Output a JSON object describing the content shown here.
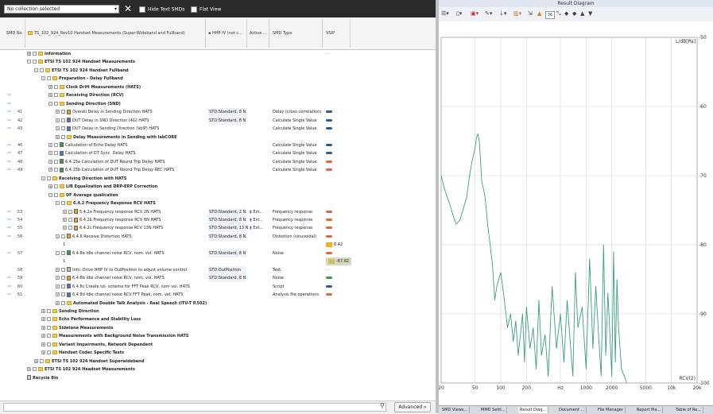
{
  "toolbar": {
    "collection": "No collection selected",
    "hide_text": "Hide Text SMDs",
    "flat_view": "Flat View"
  },
  "header": {
    "smd_no": "SMD No",
    "name": "TS_102_924_Rev10 Handset Measurements (Super-Wideband and Fullband)",
    "hhp": "HHP IV (not c...",
    "active": "Active ...",
    "smd_type": "SMD Type",
    "vsip": "VSIP"
  },
  "rows": [
    {
      "num": "",
      "arrow": "",
      "indent": 0,
      "icon": "folder",
      "pm": "+",
      "bold": true,
      "name": "Information",
      "hhp": "",
      "act": "",
      "smd": "",
      "vsip": "",
      "vsip_kind": "dash"
    },
    {
      "num": "",
      "arrow": "",
      "indent": 0,
      "icon": "folder",
      "pm": "-",
      "bold": true,
      "name": "ETSI TS 102 924 Handset Measurements",
      "hhp": "",
      "act": "",
      "smd": "",
      "vsip": "",
      "vsip_kind": ""
    },
    {
      "num": "",
      "arrow": "",
      "indent": 1,
      "icon": "folder",
      "pm": "-",
      "bold": true,
      "name": "ETSI TS 102 924 Handset Fullband",
      "hhp": "",
      "act": "",
      "smd": "",
      "vsip": "",
      "vsip_kind": ""
    },
    {
      "num": "",
      "arrow": "",
      "indent": 2,
      "icon": "folder",
      "pm": "-",
      "bold": true,
      "name": "Preparation - Delay Fullband",
      "hhp": "",
      "act": "",
      "smd": "",
      "vsip": "",
      "vsip_kind": ""
    },
    {
      "num": "",
      "arrow": "",
      "indent": 3,
      "icon": "folder",
      "pm": "+",
      "bold": true,
      "name": "Clock Drift Measurements (HATS)",
      "hhp": "",
      "act": "",
      "smd": "",
      "vsip": "",
      "vsip_kind": ""
    },
    {
      "num": "",
      "arrow": "⇨",
      "indent": 3,
      "icon": "folder",
      "pm": "+",
      "bold": true,
      "name": "Receiving Direction (RCV)",
      "hhp": "",
      "act": "",
      "smd": "",
      "vsip": "",
      "vsip_kind": ""
    },
    {
      "num": "",
      "arrow": "⇨",
      "indent": 3,
      "icon": "folder",
      "pm": "-",
      "bold": true,
      "name": "Sending Direction (SND)",
      "hhp": "",
      "act": "",
      "smd": "",
      "vsip": "",
      "vsip_kind": ""
    },
    {
      "num": "41",
      "arrow": "⇨",
      "indent": 4,
      "icon": "doc-orange",
      "pm": "+",
      "bold": false,
      "name": "Overall Delay in Sending Direction HATS",
      "hhp": "STD:Standard, 8 N",
      "act": "",
      "smd": "Delay (cross correlation)",
      "vsip": "",
      "vsip_kind": "blue"
    },
    {
      "num": "42",
      "arrow": "⇨",
      "indent": 4,
      "icon": "doc-blue",
      "pm": "+",
      "bold": false,
      "name": "DUT Delay in SND Direction (4G) HATS",
      "hhp": "STD:Standard, 8 N",
      "act": "",
      "smd": "Calculate Single Value",
      "vsip": "",
      "vsip_kind": "blue"
    },
    {
      "num": "43",
      "arrow": "⇨",
      "indent": 4,
      "icon": "doc-blue",
      "pm": "+",
      "bold": false,
      "name": "DUT Delay in Sending Direction (VoIP) HATS",
      "hhp": "",
      "act": "",
      "smd": "Calculate Single Value",
      "vsip": "",
      "vsip_kind": "blue"
    },
    {
      "num": "",
      "arrow": "",
      "indent": 4,
      "icon": "folder",
      "pm": "+",
      "bold": true,
      "name": "Delay Measurements in Sending with labCORE",
      "hhp": "",
      "act": "",
      "smd": "",
      "vsip": "",
      "vsip_kind": ""
    },
    {
      "num": "46",
      "arrow": "⇨",
      "indent": 3,
      "icon": "doc-green",
      "pm": "+",
      "bold": false,
      "name": "Calculation of Echo Delay HATS",
      "hhp": "",
      "act": "",
      "smd": "Calculate Single Value",
      "vsip": "",
      "vsip_kind": "blue"
    },
    {
      "num": "47",
      "arrow": "⇨",
      "indent": 3,
      "icon": "doc-blue",
      "pm": "+",
      "bold": false,
      "name": "Calculation of DT Sync. Delay HATS",
      "hhp": "",
      "act": "",
      "smd": "Calculate Single Value",
      "vsip": "",
      "vsip_kind": "blue"
    },
    {
      "num": "48",
      "arrow": "⇨",
      "indent": 3,
      "icon": "doc-green",
      "pm": "+",
      "bold": false,
      "name": "6.4.15a Calculation of DUT Round Trip Delay HATS",
      "hhp": "",
      "act": "",
      "smd": "Calculate Single Value",
      "vsip": "",
      "vsip_kind": "red"
    },
    {
      "num": "49",
      "arrow": "⇨",
      "indent": 3,
      "icon": "doc-green",
      "pm": "+",
      "bold": false,
      "name": "6.4.15b Calculation of DUT Round Trip Delay REC HATS",
      "hhp": "",
      "act": "",
      "smd": "Calculate Single Value",
      "vsip": "",
      "vsip_kind": "red"
    },
    {
      "num": "",
      "arrow": "",
      "indent": 2,
      "icon": "folder",
      "pm": "-",
      "bold": true,
      "name": "Receiving Direction with HATS",
      "hhp": "",
      "act": "",
      "smd": "",
      "vsip": "",
      "vsip_kind": ""
    },
    {
      "num": "",
      "arrow": "",
      "indent": 3,
      "icon": "folder",
      "pm": "+",
      "bold": true,
      "name": "LIB Equalization and DRP-ERP Correction",
      "hhp": "",
      "act": "",
      "smd": "",
      "vsip": "",
      "vsip_kind": ""
    },
    {
      "num": "",
      "arrow": "",
      "indent": 3,
      "icon": "folder",
      "pm": "-",
      "bold": true,
      "name": "DF Average qualication",
      "hhp": "",
      "act": "",
      "smd": "",
      "vsip": "",
      "vsip_kind": ""
    },
    {
      "num": "",
      "arrow": "",
      "indent": 4,
      "icon": "folder",
      "pm": "-",
      "bold": true,
      "name": "6.4.2 Frequency Response RCV HATS",
      "hhp": "",
      "act": "",
      "smd": "",
      "vsip": "",
      "vsip_kind": ""
    },
    {
      "num": "53",
      "arrow": "⇨",
      "indent": 5,
      "icon": "doc-orange",
      "pm": "+",
      "bold": false,
      "name": "5.4.2a Frequency response RCV 2N HATS",
      "hhp": "STD:Standard, 2 N",
      "act": "Ext...",
      "smd": "Frequency response",
      "vsip": "",
      "vsip_kind": "red"
    },
    {
      "num": "54",
      "arrow": "⇨",
      "indent": 5,
      "icon": "doc-orange",
      "pm": "+",
      "bold": false,
      "name": "6.4.2b Frequency response RCV 8N HATS",
      "hhp": "STD:Standard, 8 N",
      "act": "Ext...",
      "smd": "Frequency response",
      "vsip": "",
      "vsip_kind": "red"
    },
    {
      "num": "55",
      "arrow": "⇨",
      "indent": 5,
      "icon": "doc-orange",
      "pm": "+",
      "bold": false,
      "name": "6.4.2c Frequency response RCV 13N HATS",
      "hhp": "STD:Standard, 13 N",
      "act": "Ext...",
      "smd": "Frequency response",
      "vsip": "",
      "vsip_kind": "red"
    },
    {
      "num": "56",
      "arrow": "⇨",
      "indent": 4,
      "icon": "doc-orange",
      "pm": "+",
      "bold": false,
      "name": "6.4.6 Receive Distortion HATS",
      "hhp": "STD:Standard, 8 N",
      "act": "",
      "smd": "Distortion (sinusoidal)",
      "vsip": "",
      "vsip_kind": "red"
    },
    {
      "num": "",
      "arrow": "",
      "indent": 5,
      "icon": "",
      "pm": "",
      "bold": false,
      "name": "1",
      "hhp": "",
      "act": "",
      "smd": "",
      "vsip": "6.42",
      "vsip_kind": "badge-yellow"
    },
    {
      "num": "57",
      "arrow": "⇨",
      "indent": 4,
      "icon": "doc-green",
      "pm": "-",
      "bold": false,
      "name": "6.4.8a Idle channel noise RCV, nom. vol. HATS",
      "hhp": "STD:Standard, 8 N",
      "act": "",
      "smd": "Noise",
      "vsip": "",
      "vsip_kind": "red"
    },
    {
      "num": "",
      "arrow": "",
      "indent": 5,
      "icon": "",
      "pm": "",
      "bold": false,
      "name": "1",
      "hhp": "",
      "act": "",
      "smd": "",
      "vsip": "-67.82",
      "vsip_kind": "badge-gray"
    },
    {
      "num": "58",
      "arrow": "",
      "indent": 4,
      "icon": "doc-gray",
      "pm": "+",
      "bold": false,
      "name": "Info: Drive HHP IV to OutPosition to adjust volume control",
      "hhp": "STD:OutPosition",
      "act": "",
      "smd": "Text",
      "vsip": "",
      "vsip_kind": "dash"
    },
    {
      "num": "59",
      "arrow": "⇨",
      "indent": 4,
      "icon": "doc-orange",
      "pm": "+",
      "bold": false,
      "name": "6.4.8b Idle channel noise RCV, nom. vol. HATS",
      "hhp": "STD:Standard, 8 N",
      "act": "",
      "smd": "Noise",
      "vsip": "",
      "vsip_kind": "green"
    },
    {
      "num": "60",
      "arrow": "⇨",
      "indent": 4,
      "icon": "doc-blue",
      "pm": "+",
      "bold": false,
      "name": "6.4.8c Create tol. scheme for FFT Peak RCV, nom vol. HATS",
      "hhp": "",
      "act": "",
      "smd": "Script",
      "vsip": "",
      "vsip_kind": "blue"
    },
    {
      "num": "61",
      "arrow": "⇨",
      "indent": 4,
      "icon": "doc-blue",
      "pm": "+",
      "bold": false,
      "name": "6.4.8d Idle channel noise RCV FFT Peak, nom. vol. HATS",
      "hhp": "",
      "act": "",
      "smd": "Analysis file operations",
      "vsip": "",
      "vsip_kind": "red"
    },
    {
      "num": "",
      "arrow": "",
      "indent": 4,
      "icon": "folder",
      "pm": "+",
      "bold": true,
      "name": "Automated Double Talk Analysis - Real Speech (ITU-T P.502)",
      "hhp": "",
      "act": "",
      "smd": "",
      "vsip": "",
      "vsip_kind": ""
    },
    {
      "num": "",
      "arrow": "",
      "indent": 2,
      "icon": "folder",
      "pm": "+",
      "bold": true,
      "name": "Sending Direction",
      "hhp": "",
      "act": "",
      "smd": "",
      "vsip": "",
      "vsip_kind": ""
    },
    {
      "num": "",
      "arrow": "",
      "indent": 2,
      "icon": "folder",
      "pm": "+",
      "bold": true,
      "name": "Echo Performance and Stability Loss",
      "hhp": "",
      "act": "",
      "smd": "",
      "vsip": "",
      "vsip_kind": ""
    },
    {
      "num": "",
      "arrow": "",
      "indent": 2,
      "icon": "folder",
      "pm": "+",
      "bold": true,
      "name": "Sidetone Measurements",
      "hhp": "",
      "act": "",
      "smd": "",
      "vsip": "",
      "vsip_kind": ""
    },
    {
      "num": "",
      "arrow": "",
      "indent": 2,
      "icon": "folder",
      "pm": "+",
      "bold": true,
      "name": "Measurements with Background Noise Transmission HATS",
      "hhp": "",
      "act": "",
      "smd": "",
      "vsip": "",
      "vsip_kind": ""
    },
    {
      "num": "",
      "arrow": "",
      "indent": 2,
      "icon": "folder",
      "pm": "+",
      "bold": true,
      "name": "Variant Impairments, Network Dependent",
      "hhp": "",
      "act": "",
      "smd": "",
      "vsip": "",
      "vsip_kind": ""
    },
    {
      "num": "",
      "arrow": "",
      "indent": 2,
      "icon": "folder",
      "pm": "+",
      "bold": true,
      "name": "Handset Codec Specific Tests",
      "hhp": "",
      "act": "",
      "smd": "",
      "vsip": "",
      "vsip_kind": ""
    },
    {
      "num": "",
      "arrow": "",
      "indent": 1,
      "icon": "folder",
      "pm": "+",
      "bold": true,
      "name": "ETSI TS 102 924 Handset Superwideband",
      "hhp": "",
      "act": "",
      "smd": "",
      "vsip": "",
      "vsip_kind": ""
    },
    {
      "num": "",
      "arrow": "",
      "indent": 0,
      "icon": "folder",
      "pm": "+",
      "bold": true,
      "name": "ETSI TS 102 924 Headset Measurements",
      "hhp": "",
      "act": "",
      "smd": "",
      "vsip": "",
      "vsip_kind": ""
    },
    {
      "num": "",
      "arrow": "",
      "indent": 0,
      "icon": "bin",
      "pm": "",
      "bold": true,
      "name": "Recycle Bin",
      "hhp": "",
      "act": "",
      "smd": "",
      "vsip": "",
      "vsip_kind": ""
    }
  ],
  "bottom": {
    "advanced": "Advanced »"
  },
  "right_panel": {
    "title": "Result Diagram",
    "zoom": "36",
    "tabs": [
      "SMD Views...",
      "MMD Setti...",
      "Result Diag...",
      "Document ...",
      "File Manager",
      "Report Ma...",
      "Table of Re..."
    ],
    "active_tab": 2
  },
  "chart_data": {
    "type": "line",
    "title": "",
    "xlabel": "RCV(2)",
    "ylabel": "L/dB[Pa]",
    "xscale": "log",
    "xlim": [
      20,
      20000
    ],
    "ylim": [
      -100,
      -50
    ],
    "x_ticks": [
      "20",
      "50",
      "100",
      "200",
      "Hz",
      "1000",
      "2000",
      "5000",
      "10k",
      "20k"
    ],
    "x_tick_values": [
      20,
      50,
      100,
      200,
      500,
      1000,
      2000,
      5000,
      10000,
      20000
    ],
    "y_ticks": [
      -50,
      -60,
      -70,
      -80,
      -90,
      -100
    ],
    "grid": true,
    "series": [
      {
        "color": "#3aa07a",
        "x": [
          20,
          22,
          25,
          28,
          30,
          33,
          36,
          40,
          43,
          46,
          50,
          52,
          54,
          56,
          58,
          60,
          63,
          66,
          70,
          75,
          80,
          85,
          90,
          100,
          110,
          120,
          130,
          140,
          150,
          160,
          170,
          180,
          190,
          200,
          220,
          240,
          260,
          280,
          300,
          330,
          360,
          400,
          450,
          500,
          550,
          600,
          650,
          700,
          750,
          800,
          900,
          1000,
          1100,
          1200,
          1300,
          1400,
          1500,
          1600,
          1700,
          1800,
          1900,
          2000,
          2100,
          2200,
          2300,
          2400,
          2500,
          2600,
          2800,
          3000
        ],
        "y": [
          -70,
          -72,
          -74,
          -76,
          -77,
          -76.5,
          -75,
          -73,
          -70,
          -68,
          -66,
          -64.5,
          -64,
          -65,
          -68,
          -71,
          -72,
          -73.5,
          -77,
          -80,
          -83,
          -88,
          -86,
          -84,
          -88,
          -92,
          -90,
          -94,
          -91,
          -96,
          -93,
          -90,
          -97,
          -89,
          -95,
          -92,
          -98,
          -88,
          -96,
          -93,
          -99,
          -86,
          -95,
          -90,
          -97,
          -88,
          -94,
          -99,
          -84,
          -92,
          -89,
          -98,
          -82,
          -95,
          -86,
          -93,
          -99,
          -80,
          -96,
          -87,
          -93,
          -99,
          -81,
          -97,
          -85,
          -92,
          -95,
          -98,
          -99,
          -100
        ]
      }
    ]
  }
}
